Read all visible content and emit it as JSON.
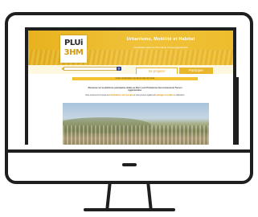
{
  "site": {
    "logo_line1": "PLUi",
    "logo_line2": "3HM",
    "banner_title": "Urbanisme, Mobilité et Habitat",
    "banner_subtitle": "Concertation autour du PLUi-HM de Thonon Agglomération",
    "search_icon": "search-icon",
    "tabs": [
      {
        "label": "Se projeter",
        "active": true
      },
      {
        "label": "Participer",
        "active": false
      }
    ],
    "notice_text": "Cette concertation est désormais terminée",
    "intro_line1": "Bienvenue sur la plateforme participative dédiée au Plan Local d'Urbanisme intercommunal de Thonon Agglomération.",
    "intro_line2_before": "Vous trouverez ici toutes les ",
    "intro_line2_highlight1": "informations sur le projet",
    "intro_line2_mid": " et vous pouvez également ",
    "intro_line2_highlight2": "partager vos idées",
    "intro_line2_after": " et réflexions."
  },
  "colors": {
    "brand_yellow": "#e8b21e",
    "monitor_frame": "#1f1f1f",
    "search_button": "#2c3e88"
  }
}
